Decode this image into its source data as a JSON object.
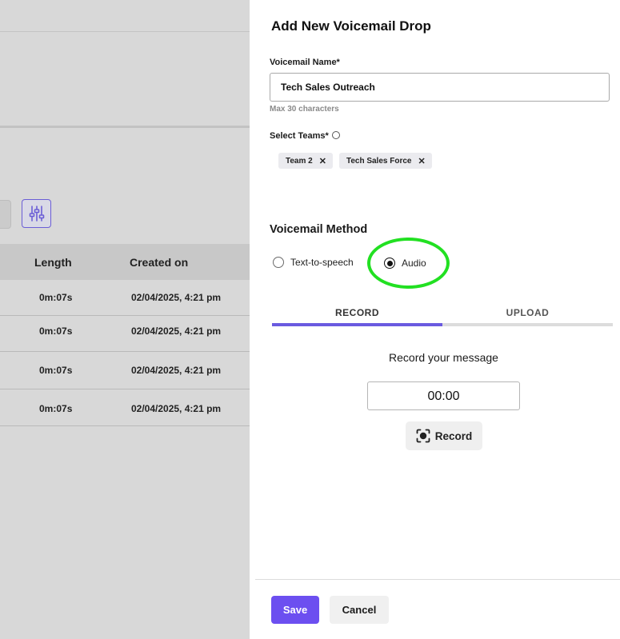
{
  "background": {
    "table": {
      "headers": {
        "length": "Length",
        "created_on": "Created on"
      },
      "rows": [
        {
          "length": "0m:07s",
          "created_on": "02/04/2025, 4:21 pm"
        },
        {
          "length": "0m:07s",
          "created_on": "02/04/2025, 4:21 pm"
        },
        {
          "length": "0m:07s",
          "created_on": "02/04/2025, 4:21 pm"
        },
        {
          "length": "0m:07s",
          "created_on": "02/04/2025, 4:21 pm"
        }
      ]
    },
    "accent_color": "#6b5ed6",
    "filter_icon": "sliders-icon"
  },
  "drawer": {
    "title": "Add New Voicemail Drop",
    "voicemail_name": {
      "label": "Voicemail Name*",
      "value": "Tech Sales Outreach",
      "hint": "Max 30 characters"
    },
    "teams": {
      "label": "Select Teams*",
      "selected": [
        {
          "label": "Team 2",
          "remove_icon": "close-icon"
        },
        {
          "label": "Tech Sales Force",
          "remove_icon": "close-icon"
        }
      ]
    },
    "method": {
      "title": "Voicemail Method",
      "options": [
        {
          "label": "Text-to-speech",
          "checked": false
        },
        {
          "label": "Audio",
          "checked": true
        }
      ],
      "annotation_color": "#22e022"
    },
    "tabs": [
      {
        "label": "RECORD",
        "active": true
      },
      {
        "label": "UPLOAD",
        "active": false
      }
    ],
    "recorder": {
      "heading": "Record your message",
      "timer": "00:00",
      "record_label": "Record",
      "record_icon": "record-icon"
    },
    "footer": {
      "save_label": "Save",
      "cancel_label": "Cancel",
      "primary_color": "#6c4ff0"
    }
  }
}
